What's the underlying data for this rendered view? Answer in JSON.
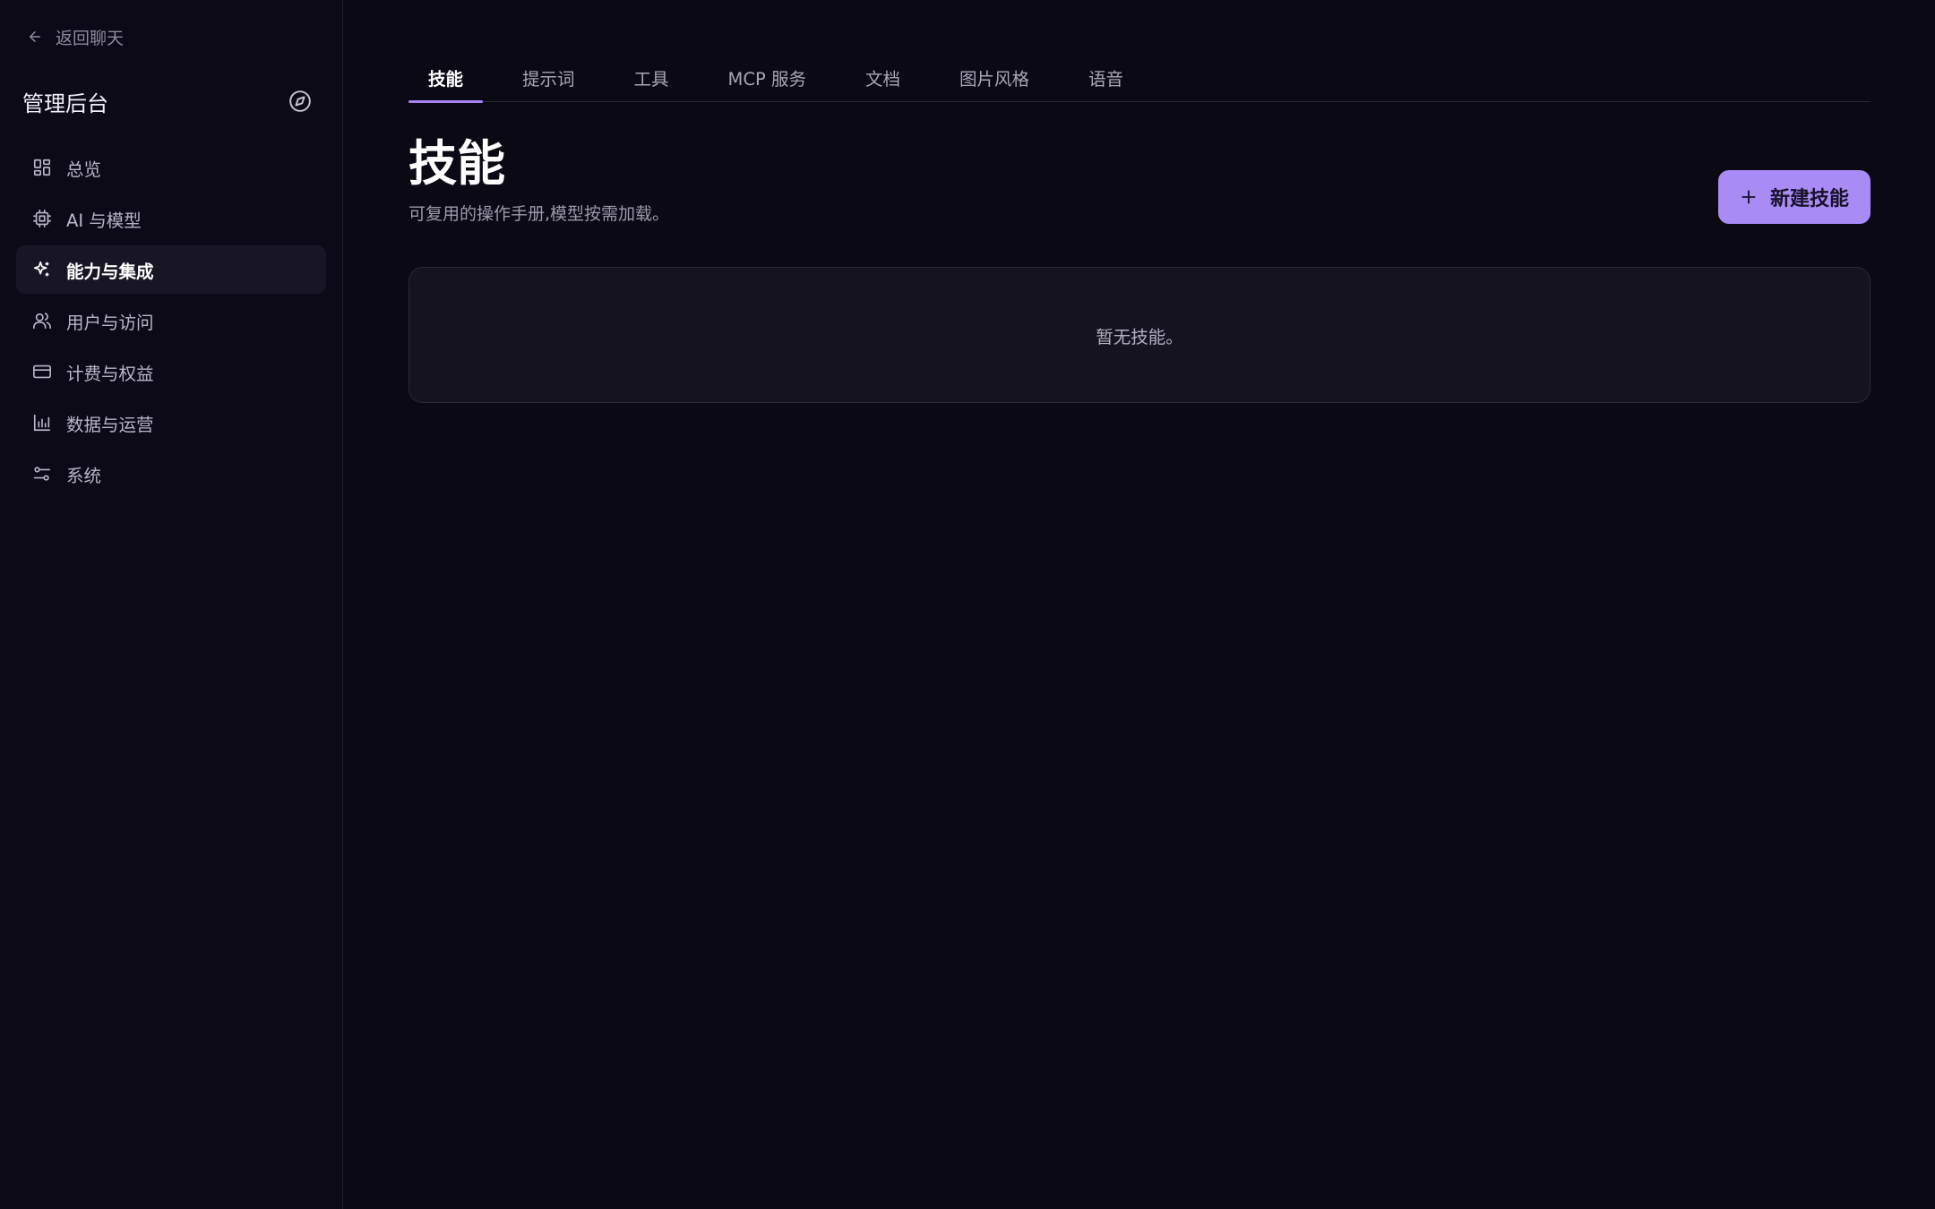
{
  "sidebar": {
    "back_label": "返回聊天",
    "title": "管理后台",
    "items": [
      {
        "label": "总览",
        "icon": "dashboard-icon",
        "active": false
      },
      {
        "label": "AI 与模型",
        "icon": "cpu-chip-icon",
        "active": false
      },
      {
        "label": "能力与集成",
        "icon": "sparkles-icon",
        "active": true
      },
      {
        "label": "用户与访问",
        "icon": "users-icon",
        "active": false
      },
      {
        "label": "计费与权益",
        "icon": "credit-card-icon",
        "active": false
      },
      {
        "label": "数据与运营",
        "icon": "bar-chart-icon",
        "active": false
      },
      {
        "label": "系统",
        "icon": "sliders-icon",
        "active": false
      }
    ]
  },
  "tabs": [
    {
      "label": "技能",
      "active": true
    },
    {
      "label": "提示词",
      "active": false
    },
    {
      "label": "工具",
      "active": false
    },
    {
      "label": "MCP 服务",
      "active": false
    },
    {
      "label": "文档",
      "active": false
    },
    {
      "label": "图片风格",
      "active": false
    },
    {
      "label": "语音",
      "active": false
    }
  ],
  "main": {
    "title": "技能",
    "subtitle": "可复用的操作手册,模型按需加载。",
    "new_button_label": "新建技能",
    "empty_text": "暂无技能。"
  },
  "colors": {
    "background": "#0a0914",
    "accent": "#a98bf6",
    "tab_underline": "#a783f7"
  }
}
